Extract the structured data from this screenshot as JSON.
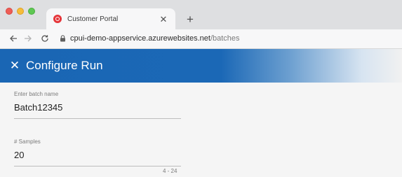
{
  "browser": {
    "tab_title": "Customer Portal",
    "tab_close_glyph": "✕",
    "new_tab_glyph": "+",
    "url_host": "cpui-demo-appservice.azurewebsites.net",
    "url_path": "/batches",
    "icons": {
      "back": "arrow-left-icon",
      "forward": "arrow-right-icon",
      "reload": "reload-icon",
      "lock": "lock-icon",
      "favicon": "customer-portal-favicon"
    }
  },
  "header": {
    "title": "Configure Run",
    "close_glyph": "✕",
    "accent_color": "#1a66b4"
  },
  "form": {
    "batch_name": {
      "label": "Enter batch name",
      "value": "Batch12345"
    },
    "samples": {
      "label": "# Samples",
      "value": "20",
      "hint": "4 - 24"
    }
  }
}
